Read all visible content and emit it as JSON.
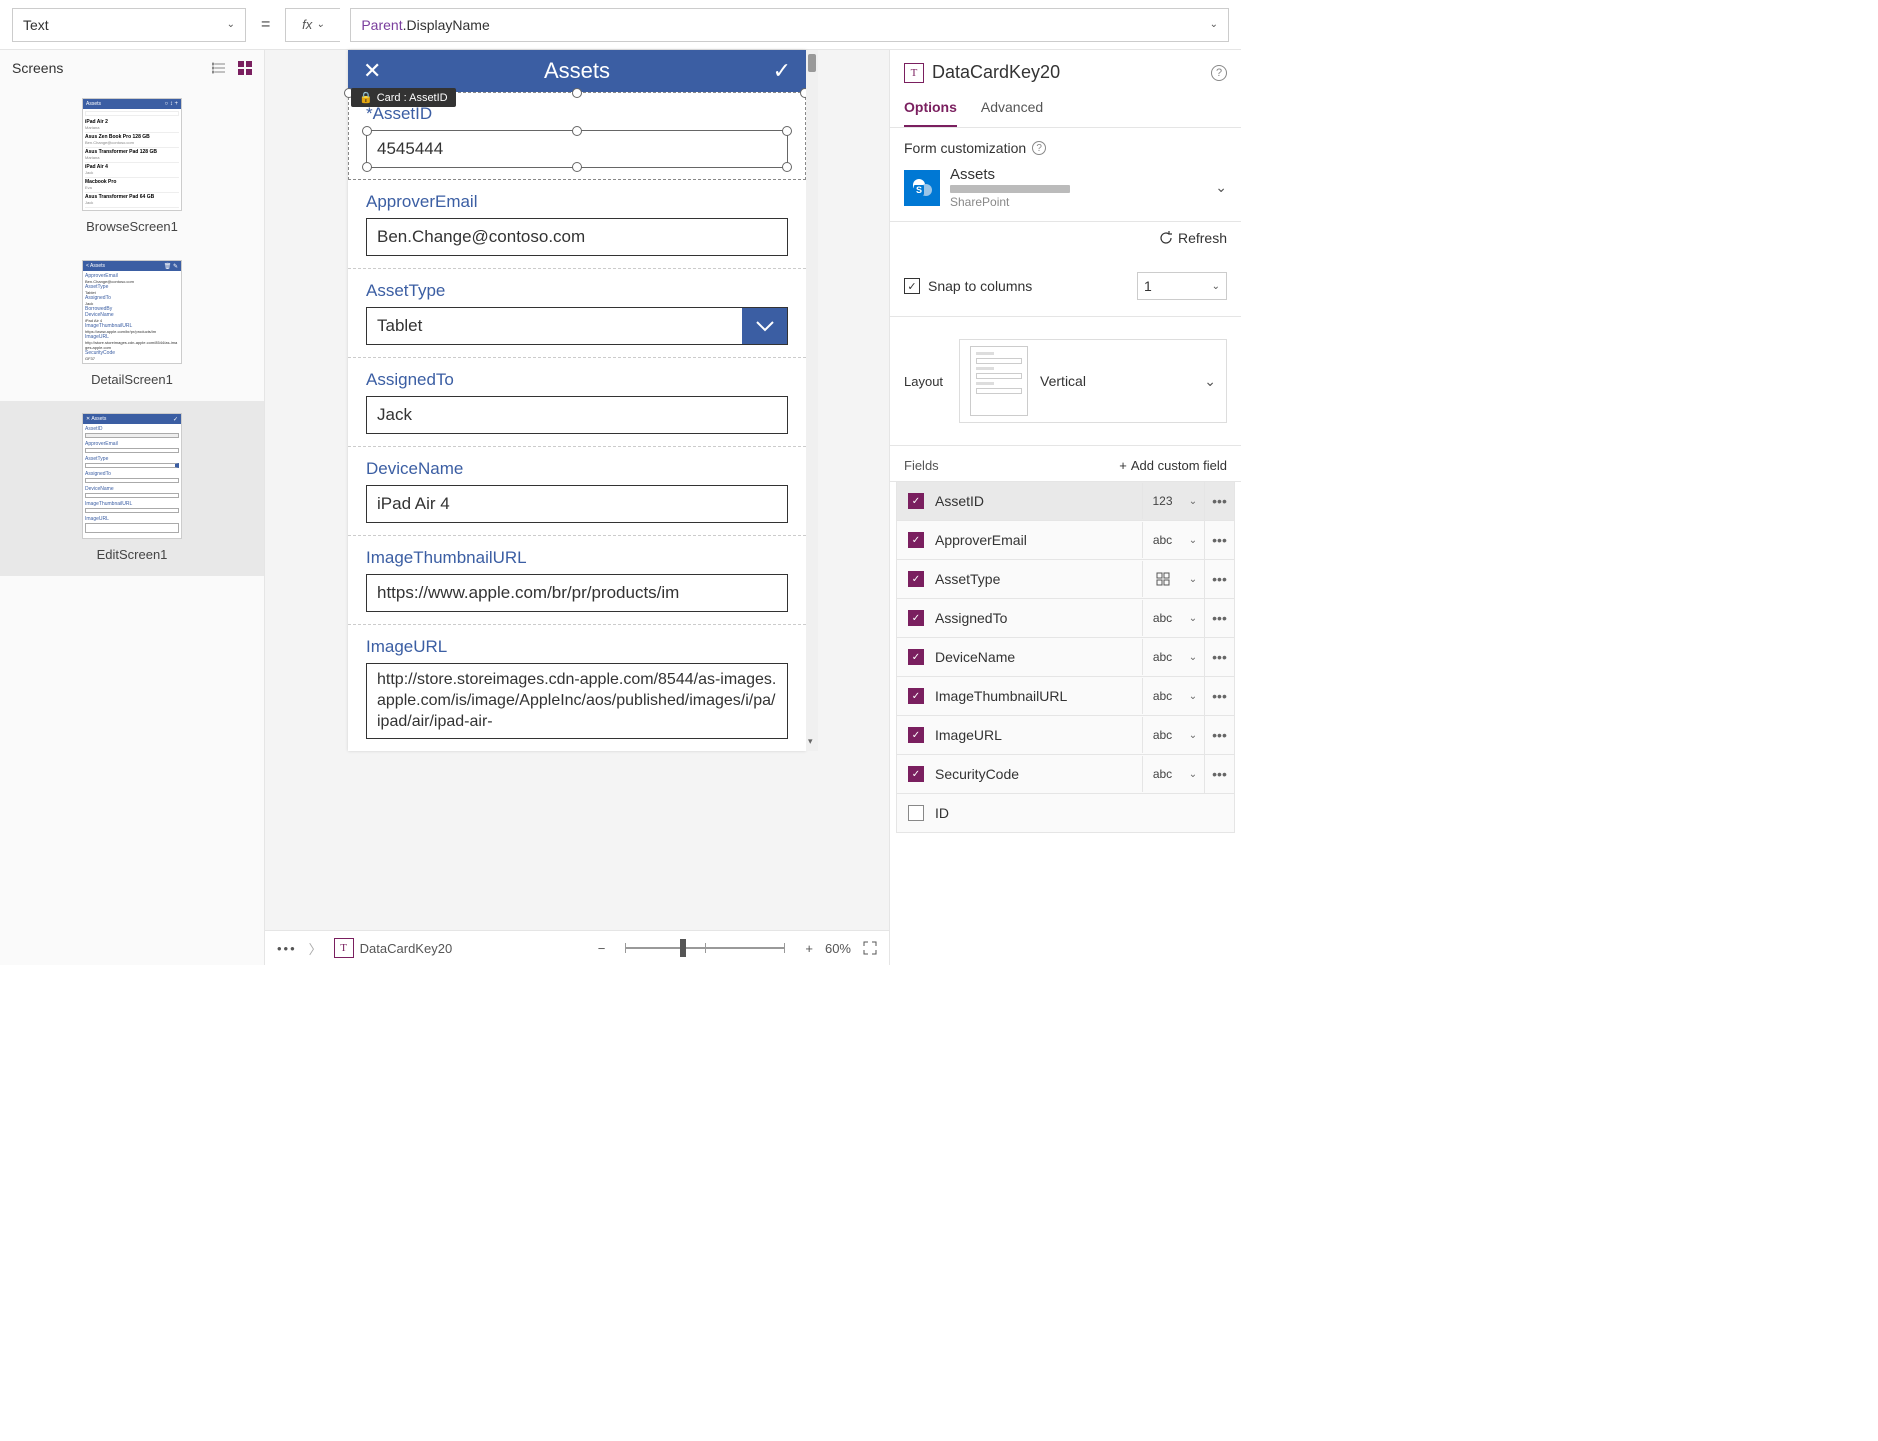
{
  "formula_bar": {
    "property": "Text",
    "formula_prefix": "Parent",
    "formula_member": ".DisplayName"
  },
  "screens": {
    "title": "Screens",
    "items": [
      {
        "name": "BrowseScreen1",
        "header": "Assets"
      },
      {
        "name": "DetailScreen1",
        "header": "Assets"
      },
      {
        "name": "EditScreen1",
        "header": "Assets"
      }
    ]
  },
  "canvas": {
    "selected_tooltip": "Card : AssetID",
    "app_header": {
      "title": "Assets"
    },
    "cards": [
      {
        "label": "AssetID",
        "required": true,
        "value": "4545444",
        "type": "text",
        "selected": true
      },
      {
        "label": "ApproverEmail",
        "value": "Ben.Change@contoso.com",
        "type": "text"
      },
      {
        "label": "AssetType",
        "value": "Tablet",
        "type": "select"
      },
      {
        "label": "AssignedTo",
        "value": "Jack",
        "type": "text"
      },
      {
        "label": "DeviceName",
        "value": "iPad Air 4",
        "type": "text"
      },
      {
        "label": "ImageThumbnailURL",
        "value": "https://www.apple.com/br/pr/products/im",
        "type": "text"
      },
      {
        "label": "ImageURL",
        "value": "http://store.storeimages.cdn-apple.com/8544/as-images.apple.com/is/image/AppleInc/aos/published/images/i/pa/ipad/air/ipad-air-",
        "type": "textarea"
      }
    ]
  },
  "props": {
    "title": "DataCardKey20",
    "tabs": {
      "options": "Options",
      "advanced": "Advanced"
    },
    "form_customization": "Form customization",
    "datasource": {
      "name": "Assets",
      "subtitle": "SharePoint"
    },
    "refresh": "Refresh",
    "snap_label": "Snap to columns",
    "snap_cols": "1",
    "layout_label": "Layout",
    "layout_value": "Vertical",
    "fields_label": "Fields",
    "add_field": "Add custom field",
    "fields": [
      {
        "name": "AssetID",
        "type": "123",
        "checked": true,
        "selected": true
      },
      {
        "name": "ApproverEmail",
        "type": "abc",
        "checked": true
      },
      {
        "name": "AssetType",
        "type": "grid",
        "checked": true
      },
      {
        "name": "AssignedTo",
        "type": "abc",
        "checked": true
      },
      {
        "name": "DeviceName",
        "type": "abc",
        "checked": true
      },
      {
        "name": "ImageThumbnailURL",
        "type": "abc",
        "checked": true
      },
      {
        "name": "ImageURL",
        "type": "abc",
        "checked": true
      },
      {
        "name": "SecurityCode",
        "type": "abc",
        "checked": true
      },
      {
        "name": "ID",
        "type": "",
        "checked": false
      }
    ]
  },
  "status": {
    "crumb": "DataCardKey20",
    "zoom": "60%"
  }
}
